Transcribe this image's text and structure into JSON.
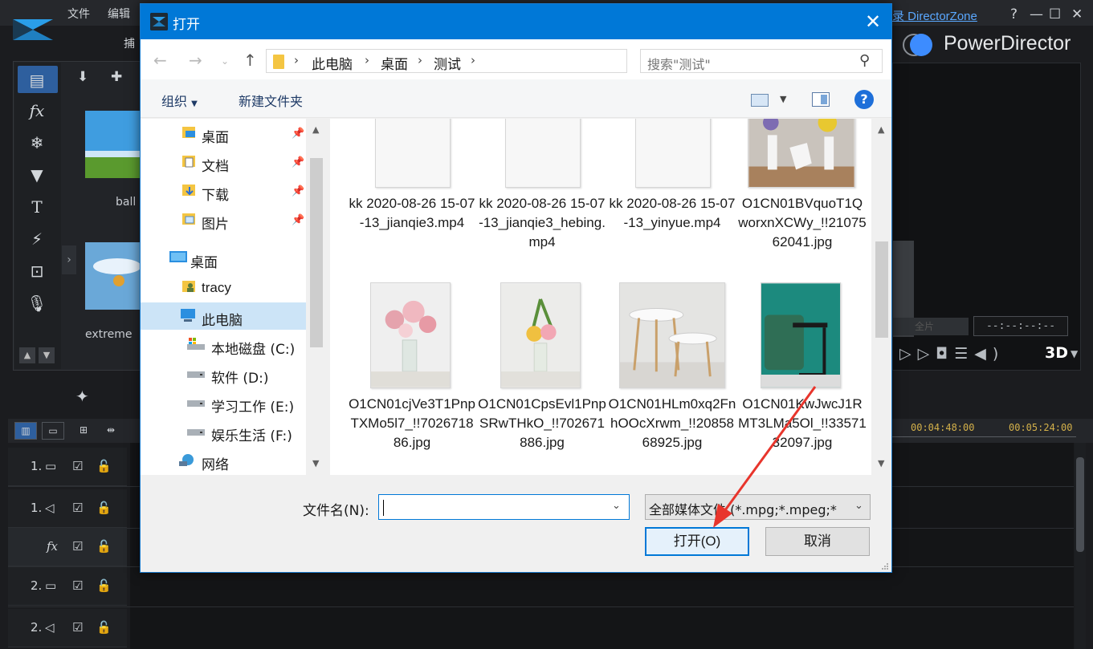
{
  "app": {
    "menu": [
      "文件",
      "编辑"
    ],
    "capture_label": "捕",
    "director_zone": "录 DirectorZone",
    "title": "PowerDirector",
    "help_glyph": "?",
    "minimize_glyph": "—",
    "maximize_glyph": "☐",
    "close_glyph": "✕",
    "library_items": [
      "ball",
      "extreme"
    ],
    "full_label": "全片",
    "timecode": "--:--:--:--",
    "badge_3d": "3D",
    "ruler_times": [
      "00:04:48:00",
      "00:05:24:00"
    ],
    "tracks": [
      {
        "num": "1.",
        "kind": "video"
      },
      {
        "num": "1.",
        "kind": "audio"
      },
      {
        "num": "",
        "kind": "fx"
      },
      {
        "num": "2.",
        "kind": "video"
      },
      {
        "num": "2.",
        "kind": "audio"
      }
    ]
  },
  "dialog": {
    "title": "打开",
    "close_glyph": "✕",
    "breadcrumb": [
      "此电脑",
      "桌面",
      "测试"
    ],
    "search_placeholder": "搜索\"测试\"",
    "toolbar": {
      "organize": "组织",
      "new_folder": "新建文件夹",
      "help": "?"
    },
    "nav": [
      {
        "label": "桌面",
        "pinned": true
      },
      {
        "label": "文档",
        "pinned": true
      },
      {
        "label": "下载",
        "pinned": true
      },
      {
        "label": "图片",
        "pinned": true
      },
      {
        "label": "桌面",
        "pinned": false
      },
      {
        "label": "tracy",
        "pinned": false
      },
      {
        "label": "此电脑",
        "pinned": false,
        "selected": true
      },
      {
        "label": "本地磁盘 (C:)",
        "pinned": false
      },
      {
        "label": "软件 (D:)",
        "pinned": false
      },
      {
        "label": "学习工作 (E:)",
        "pinned": false
      },
      {
        "label": "娱乐生活 (F:)",
        "pinned": false
      },
      {
        "label": "网络",
        "pinned": false
      }
    ],
    "files": [
      {
        "name": "kk 2020-08-26 15-07-13_jianqie3.mp4",
        "kind": "video"
      },
      {
        "name": "kk 2020-08-26 15-07-13_jianqie3_hebing.mp4",
        "kind": "video"
      },
      {
        "name": "kk 2020-08-26 15-07-13_yinyue.mp4",
        "kind": "video"
      },
      {
        "name": "O1CN01BVquoT1QworxnXCWy_!!2107562041.jpg",
        "kind": "photo-vases"
      },
      {
        "name": "O1CN01cjVe3T1PnpTXMo5l7_!!702671886.jpg",
        "kind": "photo-roses"
      },
      {
        "name": "O1CN01CpsEvl1PnpSRwTHkO_!!702671886.jpg",
        "kind": "photo-bouquet"
      },
      {
        "name": "O1CN01HLm0xq2FnhOOcXrwm_!!2085868925.jpg",
        "kind": "photo-tables"
      },
      {
        "name": "O1CN01KwJwcJ1RMT3LMa5Ol_!!3357132097.jpg",
        "kind": "photo-chair"
      }
    ],
    "file_name_label": "文件名(N):",
    "file_name_value": "",
    "filter_value": "全部媒体文件 (*.mpg;*.mpeg;*",
    "open_button": "打开(O)",
    "cancel_button": "取消"
  },
  "colors": {
    "accent": "#0078d7",
    "annotation_arrow": "#e8352c"
  }
}
